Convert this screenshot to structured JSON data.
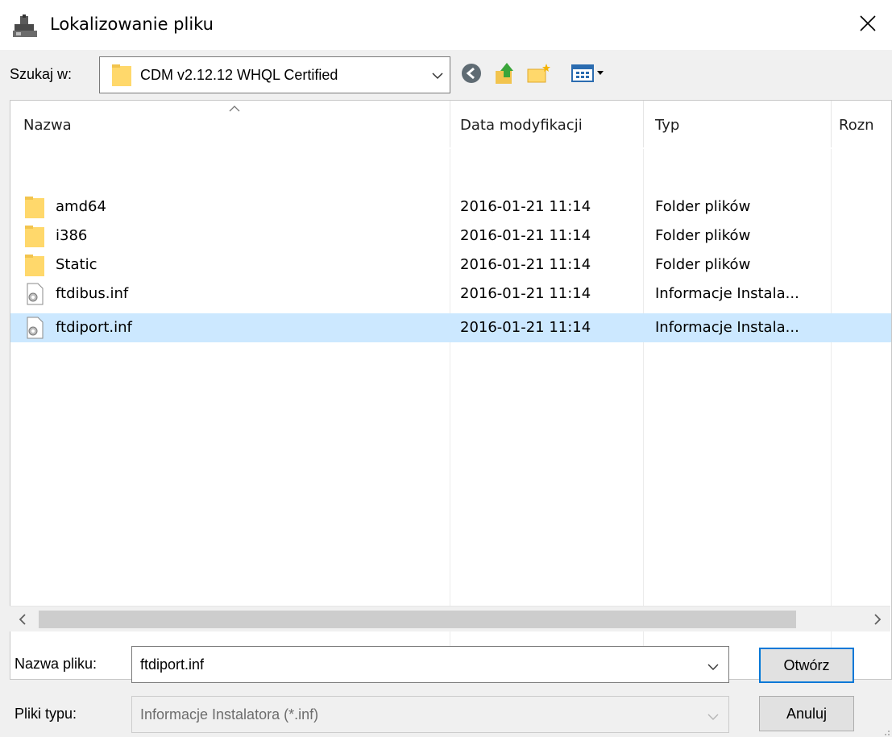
{
  "window": {
    "title": "Lokalizowanie pliku",
    "close_symbol": "×"
  },
  "look_in": {
    "label": "Szukaj w:",
    "value": "CDM v2.12.12 WHQL Certified"
  },
  "toolbar": {
    "icons": [
      "back-icon",
      "up-folder-icon",
      "new-folder-icon",
      "view-menu-icon"
    ]
  },
  "columns": [
    "Nazwa",
    "Data modyfikacji",
    "Typ",
    "Rozn"
  ],
  "files": [
    {
      "name": "amd64",
      "date": "2016-01-21 11:14",
      "type": "Folder plików",
      "icon": "folder-icon"
    },
    {
      "name": "i386",
      "date": "2016-01-21 11:14",
      "type": "Folder plików",
      "icon": "folder-icon"
    },
    {
      "name": "Static",
      "date": "2016-01-21 11:14",
      "type": "Folder plików",
      "icon": "folder-icon"
    },
    {
      "name": "ftdibus.inf",
      "date": "2016-01-21 11:14",
      "type": "Informacje Instala...",
      "icon": "setup-info-file-icon"
    },
    {
      "name": "ftdiport.inf",
      "date": "2016-01-21 11:14",
      "type": "Informacje Instala...",
      "icon": "setup-info-file-icon",
      "selected": true
    }
  ],
  "filename": {
    "label": "Nazwa pliku:",
    "value": "ftdiport.inf"
  },
  "filetype": {
    "label": "Pliki typu:",
    "value": "Informacje Instalatora (*.inf)"
  },
  "buttons": {
    "open": "Otwórz",
    "cancel": "Anuluj"
  },
  "colors": {
    "selection": "#cce8ff",
    "accent": "#0078d7",
    "folder": "#ffd86b"
  }
}
